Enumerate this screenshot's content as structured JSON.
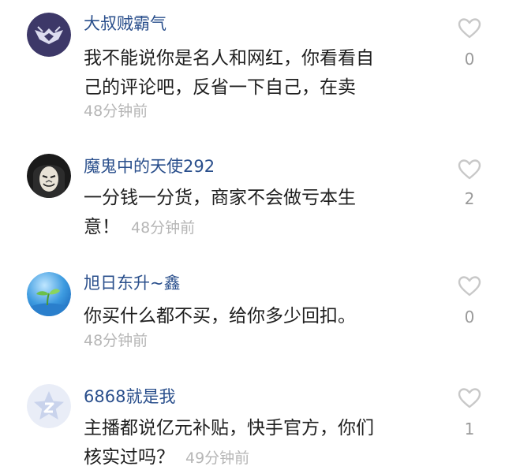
{
  "comments": [
    {
      "username": "大叔贼霸气",
      "text_lines": [
        "我不能说你是名人和网红，你看看自",
        "己的评论吧，反省一下自己，在卖"
      ],
      "time": "48分钟前",
      "likes": "0",
      "avatar": "dark-purple-emblem-avatar"
    },
    {
      "username": "魔鬼中的天使292",
      "text_lines": [
        "一分钱一分货，商家不会做亏本生",
        "意！"
      ],
      "time": "48分钟前",
      "likes": "2",
      "avatar": "masked-face-avatar"
    },
    {
      "username": "旭日东升~鑫",
      "text_lines": [
        "你买什么都不买，给你多少回扣。"
      ],
      "time": "48分钟前",
      "likes": "0",
      "avatar": "sprout-on-blue-avatar"
    },
    {
      "username": "6868就是我",
      "text_lines": [
        "主播都说亿元补贴，快手官方，你们",
        "核实过吗？"
      ],
      "time": "49分钟前",
      "likes": "1",
      "avatar": "default-star-avatar"
    }
  ],
  "colors": {
    "username": "#2a4f8c",
    "text": "#1f1f1f",
    "time": "#b6b6b6",
    "like_outline": "#c8c8c8"
  }
}
